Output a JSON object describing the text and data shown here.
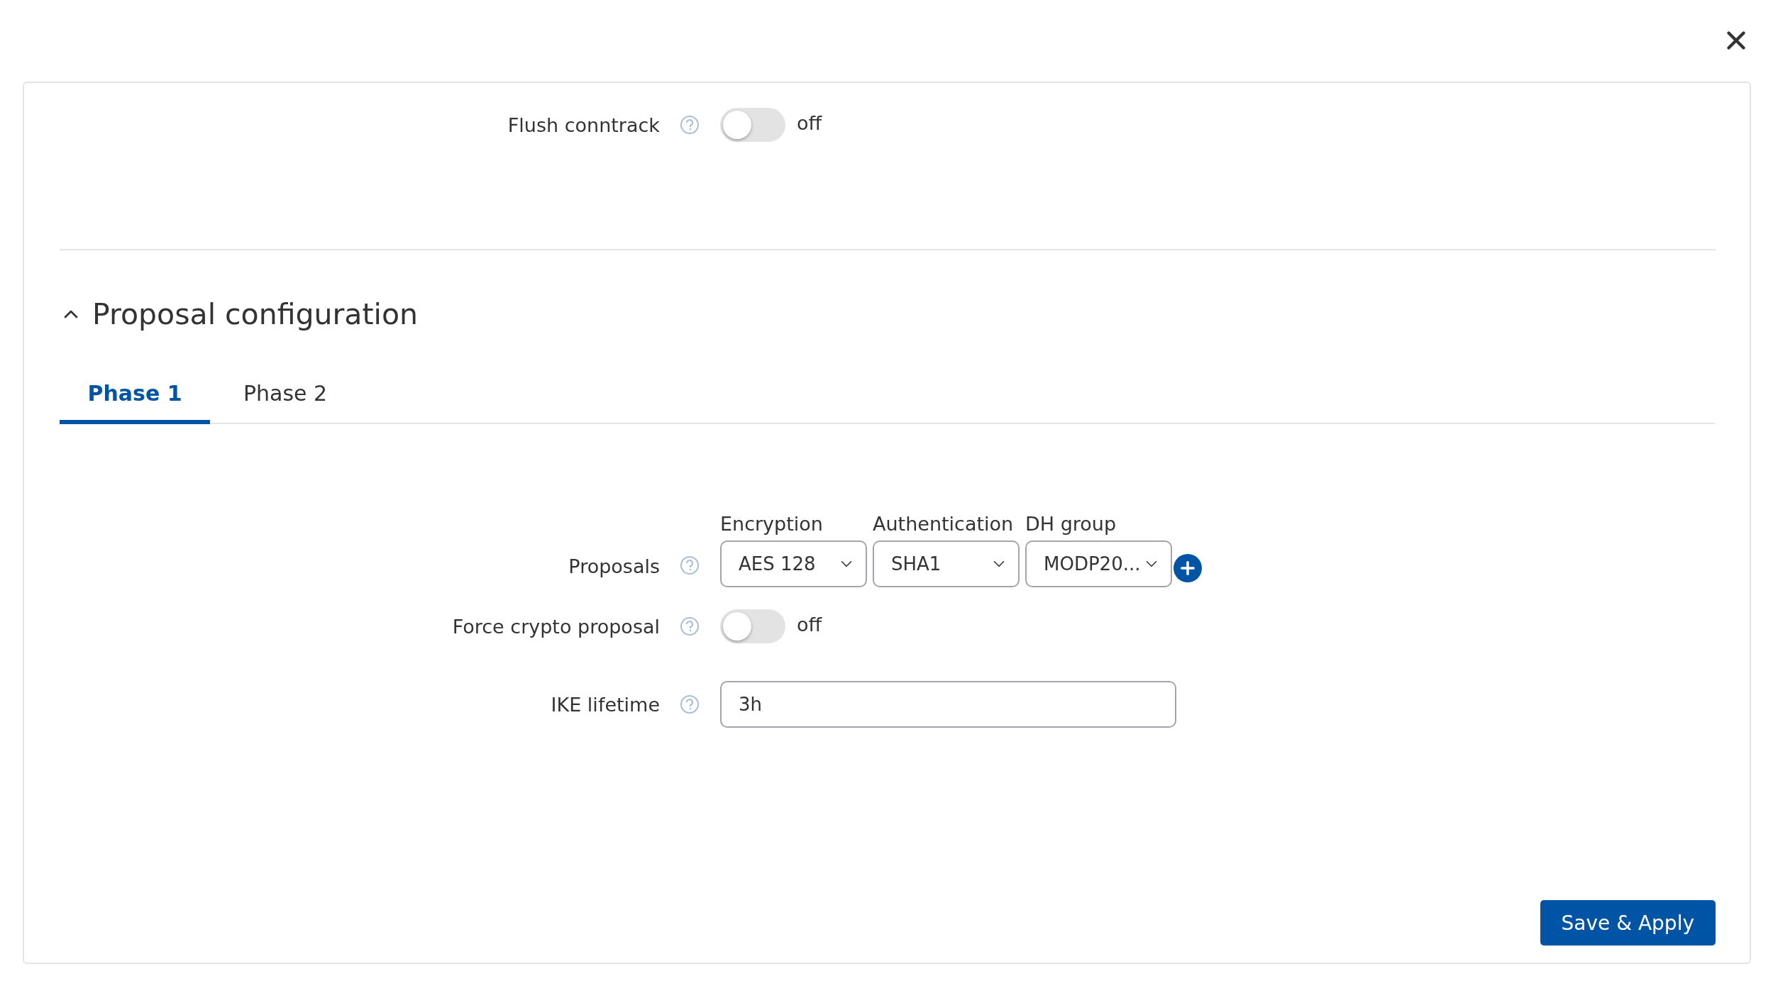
{
  "top_fields": [
    {
      "kind": "toggle",
      "label": "Flush conntrack",
      "on": false,
      "state_text": "off"
    }
  ],
  "section": {
    "title": "Proposal configuration",
    "expanded": true,
    "tabs": [
      {
        "label": "Phase 1",
        "selected": true
      },
      {
        "label": "Phase 2",
        "selected": false
      }
    ],
    "fields": [
      {
        "kind": "proposals",
        "label": "Proposals",
        "columns": [
          {
            "header": "Encryption",
            "value": "AES 128"
          },
          {
            "header": "Authentication",
            "value": "SHA1"
          },
          {
            "header": "DH group",
            "value": "MODP20..."
          }
        ]
      },
      {
        "kind": "toggle",
        "label": "Force crypto proposal",
        "on": false,
        "state_text": "off"
      },
      {
        "kind": "text",
        "label": "IKE lifetime",
        "value": "3h"
      }
    ]
  },
  "save_button": {
    "label": "Save & Apply"
  }
}
